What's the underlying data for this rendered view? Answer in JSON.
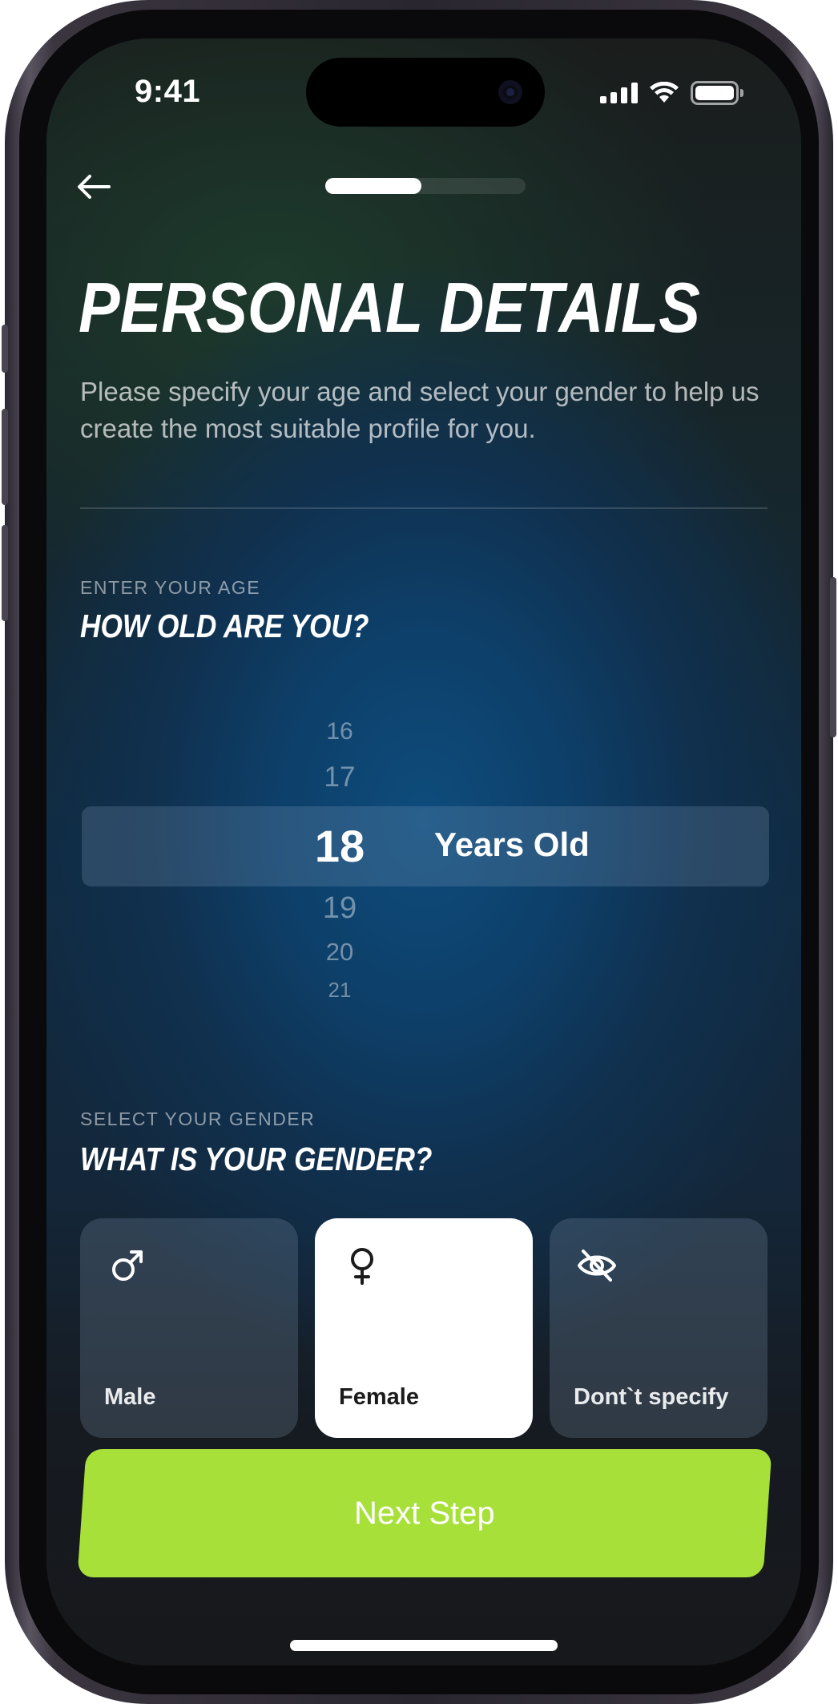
{
  "status_bar": {
    "time": "9:41"
  },
  "header": {
    "progress": 0.48
  },
  "page": {
    "title": "PERSONAL DETAILS",
    "subtitle": "Please specify your age and select your gender to help us create the most suitable profile for you."
  },
  "age_section": {
    "label": "ENTER YOUR AGE",
    "question": "HOW OLD ARE YOU?",
    "options": [
      "16",
      "17",
      "18",
      "19",
      "20",
      "21"
    ],
    "selected": "18",
    "unit": "Years Old"
  },
  "gender_section": {
    "label": "SELECT YOUR GENDER",
    "question": "WHAT IS YOUR GENDER?",
    "options": [
      {
        "label": "Male",
        "icon": "male-icon",
        "selected": false
      },
      {
        "label": "Female",
        "icon": "female-icon",
        "selected": true
      },
      {
        "label": "Dont`t specify",
        "icon": "eye-off-icon",
        "selected": false
      }
    ]
  },
  "footer": {
    "next_label": "Next Step"
  },
  "colors": {
    "accent": "#a8e03a",
    "background_top": "#1a1d1c",
    "background_mid": "#0e4c7c"
  }
}
